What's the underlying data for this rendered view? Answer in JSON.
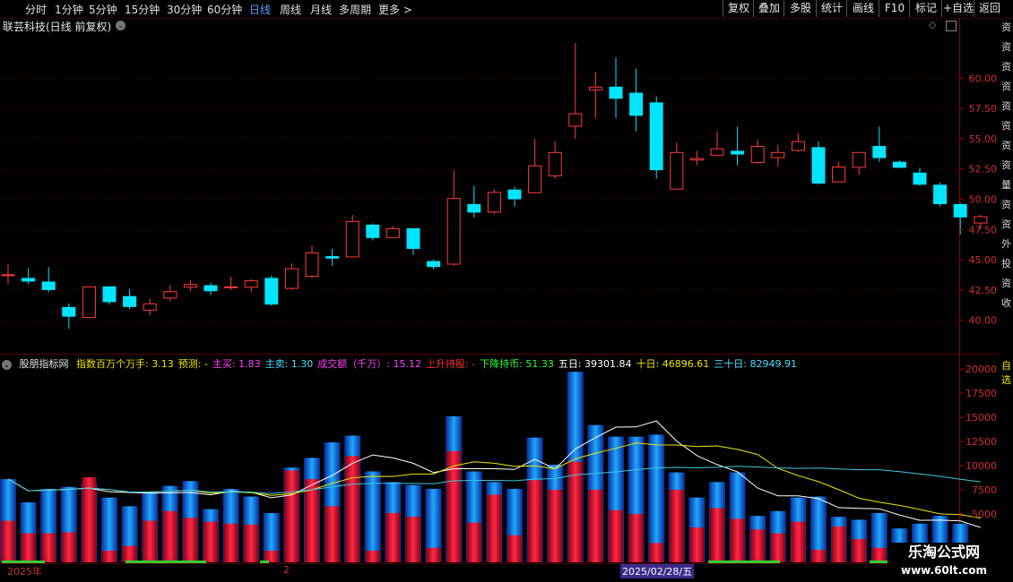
{
  "toolbar": {
    "periods": [
      {
        "label": "分时",
        "active": false
      },
      {
        "label": "1分钟",
        "active": false
      },
      {
        "label": "5分钟",
        "active": false
      },
      {
        "label": "15分钟",
        "active": false
      },
      {
        "label": "30分钟",
        "active": false
      },
      {
        "label": "60分钟",
        "active": false
      },
      {
        "label": "日线",
        "active": true
      },
      {
        "label": "周线",
        "active": false
      },
      {
        "label": "月线",
        "active": false
      },
      {
        "label": "多周期",
        "active": false
      },
      {
        "label": "更多",
        "active": false
      }
    ],
    "actions": [
      "复权",
      "叠加",
      "多股",
      "统计",
      "画线",
      "F10",
      "标记",
      "+自选",
      "返回"
    ]
  },
  "stock_title": "联芸科技(日线 前复权)",
  "price_axis": {
    "ticks": [
      "60.00",
      "57.50",
      "55.00",
      "52.50",
      "50.00",
      "47.50",
      "45.00",
      "42.50",
      "40.00"
    ]
  },
  "volume_axis": {
    "ticks": [
      "20000",
      "17500",
      "15000",
      "12500",
      "10000",
      "7500",
      "5000"
    ]
  },
  "indicator": {
    "name": "股朋指标网",
    "items": [
      {
        "label": "指数百万个万手: 3.13",
        "color": "#e8e800"
      },
      {
        "label": "预测: -",
        "color": "#e8e800"
      },
      {
        "label": "主买: 1.83",
        "color": "#ff40ff"
      },
      {
        "label": "主卖: 1.30",
        "color": "#40e0ff"
      },
      {
        "label": "成交额（千万）: 15.12",
        "color": "#ff40ff"
      },
      {
        "label": "上升持股: -",
        "color": "#ff3030"
      },
      {
        "label": "下降持币: 51.33",
        "color": "#30ff30"
      },
      {
        "label": "五日: 39301.84",
        "color": "#ffffff"
      },
      {
        "label": "十日: 46896.61",
        "color": "#e8e800"
      },
      {
        "label": "三十日: 82949.91",
        "color": "#40e0ff"
      }
    ]
  },
  "right_strip": [
    "资",
    "资",
    "资",
    "资",
    "资",
    "资",
    "资",
    "资",
    "量",
    "资",
    "资",
    "外",
    "投",
    "资",
    "收"
  ],
  "right_strip_bottom": [
    "自",
    "选"
  ],
  "date_bar": {
    "year": "2025年",
    "mid": "2",
    "cursor_date": "2025/02/28/五"
  },
  "watermark": {
    "line1": "乐淘公式网",
    "line2": "www.60lt.com"
  },
  "colors": {
    "up": "#ff3b3b",
    "down": "#00e5ff",
    "vol_red": "#ff1e3c",
    "vol_blue": "#1e64ff",
    "ma5": "#ffffff",
    "ma10": "#e8e800",
    "ma30": "#40c8e0"
  },
  "chart_data": [
    {
      "type": "candlestick",
      "title": "联芸科技(日线 前复权)",
      "ylim": [
        38.5,
        63.5
      ],
      "candles": [
        {
          "o": 43.8,
          "c": 43.8,
          "h": 44.6,
          "l": 43.0
        },
        {
          "o": 43.5,
          "c": 43.2,
          "h": 44.3,
          "l": 43.0
        },
        {
          "o": 43.2,
          "c": 42.5,
          "h": 44.4,
          "l": 42.3
        },
        {
          "o": 41.1,
          "c": 40.3,
          "h": 41.4,
          "l": 39.3
        },
        {
          "o": 40.2,
          "c": 42.8,
          "h": 42.8,
          "l": 40.2
        },
        {
          "o": 42.8,
          "c": 41.5,
          "h": 42.8,
          "l": 41.3
        },
        {
          "o": 42.0,
          "c": 41.1,
          "h": 42.6,
          "l": 40.9
        },
        {
          "o": 40.8,
          "c": 41.4,
          "h": 41.8,
          "l": 40.4
        },
        {
          "o": 41.8,
          "c": 42.4,
          "h": 42.9,
          "l": 41.6
        },
        {
          "o": 42.7,
          "c": 43.0,
          "h": 43.3,
          "l": 42.4
        },
        {
          "o": 42.9,
          "c": 42.4,
          "h": 43.1,
          "l": 42.1
        },
        {
          "o": 42.8,
          "c": 42.8,
          "h": 43.6,
          "l": 42.5
        },
        {
          "o": 42.7,
          "c": 43.3,
          "h": 43.4,
          "l": 42.3
        },
        {
          "o": 43.5,
          "c": 41.3,
          "h": 43.7,
          "l": 41.2
        },
        {
          "o": 42.6,
          "c": 44.3,
          "h": 44.7,
          "l": 42.5
        },
        {
          "o": 43.6,
          "c": 45.6,
          "h": 46.2,
          "l": 43.5
        },
        {
          "o": 45.3,
          "c": 45.1,
          "h": 45.9,
          "l": 44.5
        },
        {
          "o": 45.2,
          "c": 48.2,
          "h": 48.7,
          "l": 45.2
        },
        {
          "o": 47.9,
          "c": 46.8,
          "h": 48.0,
          "l": 46.6
        },
        {
          "o": 46.8,
          "c": 47.6,
          "h": 47.8,
          "l": 46.8
        },
        {
          "o": 47.6,
          "c": 45.9,
          "h": 47.6,
          "l": 45.4
        },
        {
          "o": 44.9,
          "c": 44.4,
          "h": 45.0,
          "l": 44.2
        },
        {
          "o": 44.6,
          "c": 50.1,
          "h": 52.4,
          "l": 44.5
        },
        {
          "o": 49.6,
          "c": 48.9,
          "h": 51.1,
          "l": 48.5
        },
        {
          "o": 48.9,
          "c": 50.6,
          "h": 50.8,
          "l": 48.8
        },
        {
          "o": 50.8,
          "c": 50.0,
          "h": 51.0,
          "l": 49.4
        },
        {
          "o": 50.5,
          "c": 52.8,
          "h": 55.0,
          "l": 50.5
        },
        {
          "o": 51.9,
          "c": 53.9,
          "h": 54.8,
          "l": 51.7
        },
        {
          "o": 56.0,
          "c": 57.1,
          "h": 62.9,
          "l": 55.0
        },
        {
          "o": 59.0,
          "c": 59.3,
          "h": 60.5,
          "l": 56.7
        },
        {
          "o": 59.3,
          "c": 58.3,
          "h": 61.7,
          "l": 56.7
        },
        {
          "o": 58.8,
          "c": 56.9,
          "h": 60.8,
          "l": 55.6
        },
        {
          "o": 58.0,
          "c": 52.4,
          "h": 58.5,
          "l": 51.7
        },
        {
          "o": 50.8,
          "c": 53.9,
          "h": 54.7,
          "l": 50.8
        },
        {
          "o": 53.2,
          "c": 53.4,
          "h": 54.0,
          "l": 52.8
        },
        {
          "o": 53.6,
          "c": 54.2,
          "h": 55.6,
          "l": 53.6
        },
        {
          "o": 54.0,
          "c": 53.7,
          "h": 56.0,
          "l": 52.8
        },
        {
          "o": 53.0,
          "c": 54.4,
          "h": 54.9,
          "l": 52.9
        },
        {
          "o": 53.4,
          "c": 53.9,
          "h": 54.5,
          "l": 52.7
        },
        {
          "o": 54.0,
          "c": 54.8,
          "h": 55.5,
          "l": 53.9
        },
        {
          "o": 54.3,
          "c": 51.3,
          "h": 54.8,
          "l": 51.2
        },
        {
          "o": 51.4,
          "c": 52.7,
          "h": 53.1,
          "l": 51.4
        },
        {
          "o": 52.6,
          "c": 53.9,
          "h": 53.9,
          "l": 52.0
        },
        {
          "o": 54.4,
          "c": 53.4,
          "h": 56.0,
          "l": 53.1
        },
        {
          "o": 53.1,
          "c": 52.6,
          "h": 53.2,
          "l": 52.6
        },
        {
          "o": 52.2,
          "c": 51.2,
          "h": 52.6,
          "l": 51.1
        },
        {
          "o": 51.2,
          "c": 49.6,
          "h": 51.4,
          "l": 49.4
        },
        {
          "o": 49.6,
          "c": 48.5,
          "h": 49.7,
          "l": 47.1
        },
        {
          "o": 48.0,
          "c": 48.6,
          "h": 48.7,
          "l": 47.5
        }
      ]
    },
    {
      "type": "bar",
      "title": "股朋指标网",
      "ylim": [
        0,
        20500
      ],
      "series": [
        {
          "name": "主买",
          "values": [
            4300,
            3000,
            3000,
            3100,
            8800,
            1200,
            1700,
            4300,
            5300,
            4600,
            4200,
            4000,
            3900,
            1200,
            9500,
            8600,
            5800,
            11000,
            1200,
            5100,
            4700,
            1500,
            11500,
            4100,
            7000,
            2800,
            8500,
            7500,
            10400,
            7500,
            5400,
            5000,
            2000,
            7500,
            3600,
            5600,
            4500,
            3400,
            3000,
            4200,
            1300,
            3700,
            2400,
            1500,
            1500,
            1400,
            1200,
            1200,
            1200
          ]
        },
        {
          "name": "主卖",
          "values": [
            8600,
            6200,
            7600,
            7800,
            8200,
            6700,
            5800,
            7300,
            7900,
            8400,
            5500,
            7600,
            6800,
            5100,
            9800,
            10800,
            12400,
            13100,
            9400,
            8300,
            8000,
            7600,
            15100,
            9400,
            8300,
            7600,
            12900,
            10100,
            19700,
            14200,
            13000,
            13000,
            13200,
            9300,
            6700,
            8300,
            9300,
            4800,
            5300,
            6700,
            6800,
            4700,
            4400,
            5100,
            3500,
            4000,
            4800,
            4000,
            1700
          ]
        }
      ]
    }
  ]
}
